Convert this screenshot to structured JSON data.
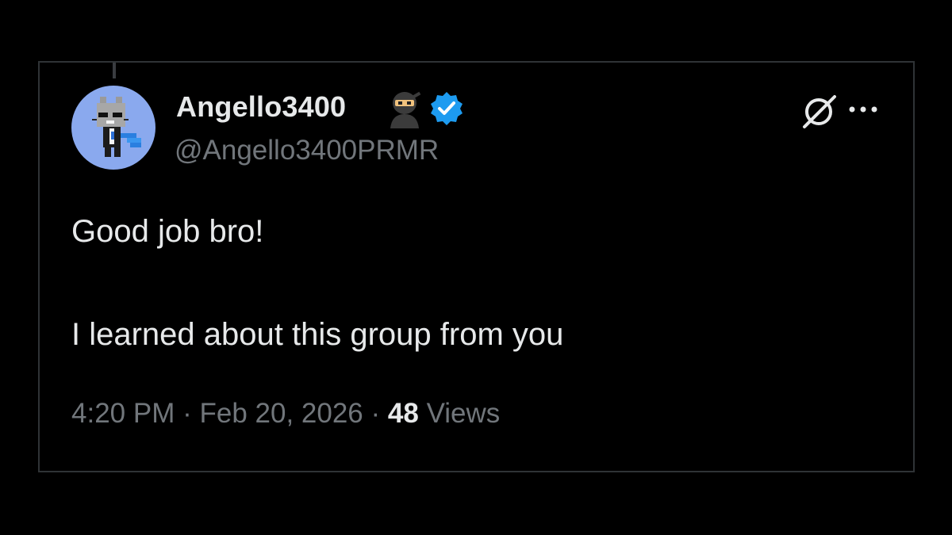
{
  "tweet": {
    "author": {
      "display_name": "Angello3400",
      "handle": "@Angello3400PRMR",
      "badges": [
        "ninja-emoji",
        "verified-badge"
      ],
      "avatar": "pixel-cat-avatar"
    },
    "text_lines": [
      "Good job bro!",
      "I learned about this group from you"
    ],
    "time": "4:20 PM",
    "separator": "·",
    "date": "Feb 20, 2026",
    "views_count": "48",
    "views_label": "Views"
  },
  "actions": {
    "grok_icon": "grok-icon",
    "more_icon": "more-icon"
  },
  "colors": {
    "background": "#000000",
    "border": "#2f3336",
    "primary_text": "#e7e9ea",
    "secondary_text": "#71767b",
    "verified_blue": "#1d9bf0",
    "avatar_bg": "#8aa9ee"
  }
}
